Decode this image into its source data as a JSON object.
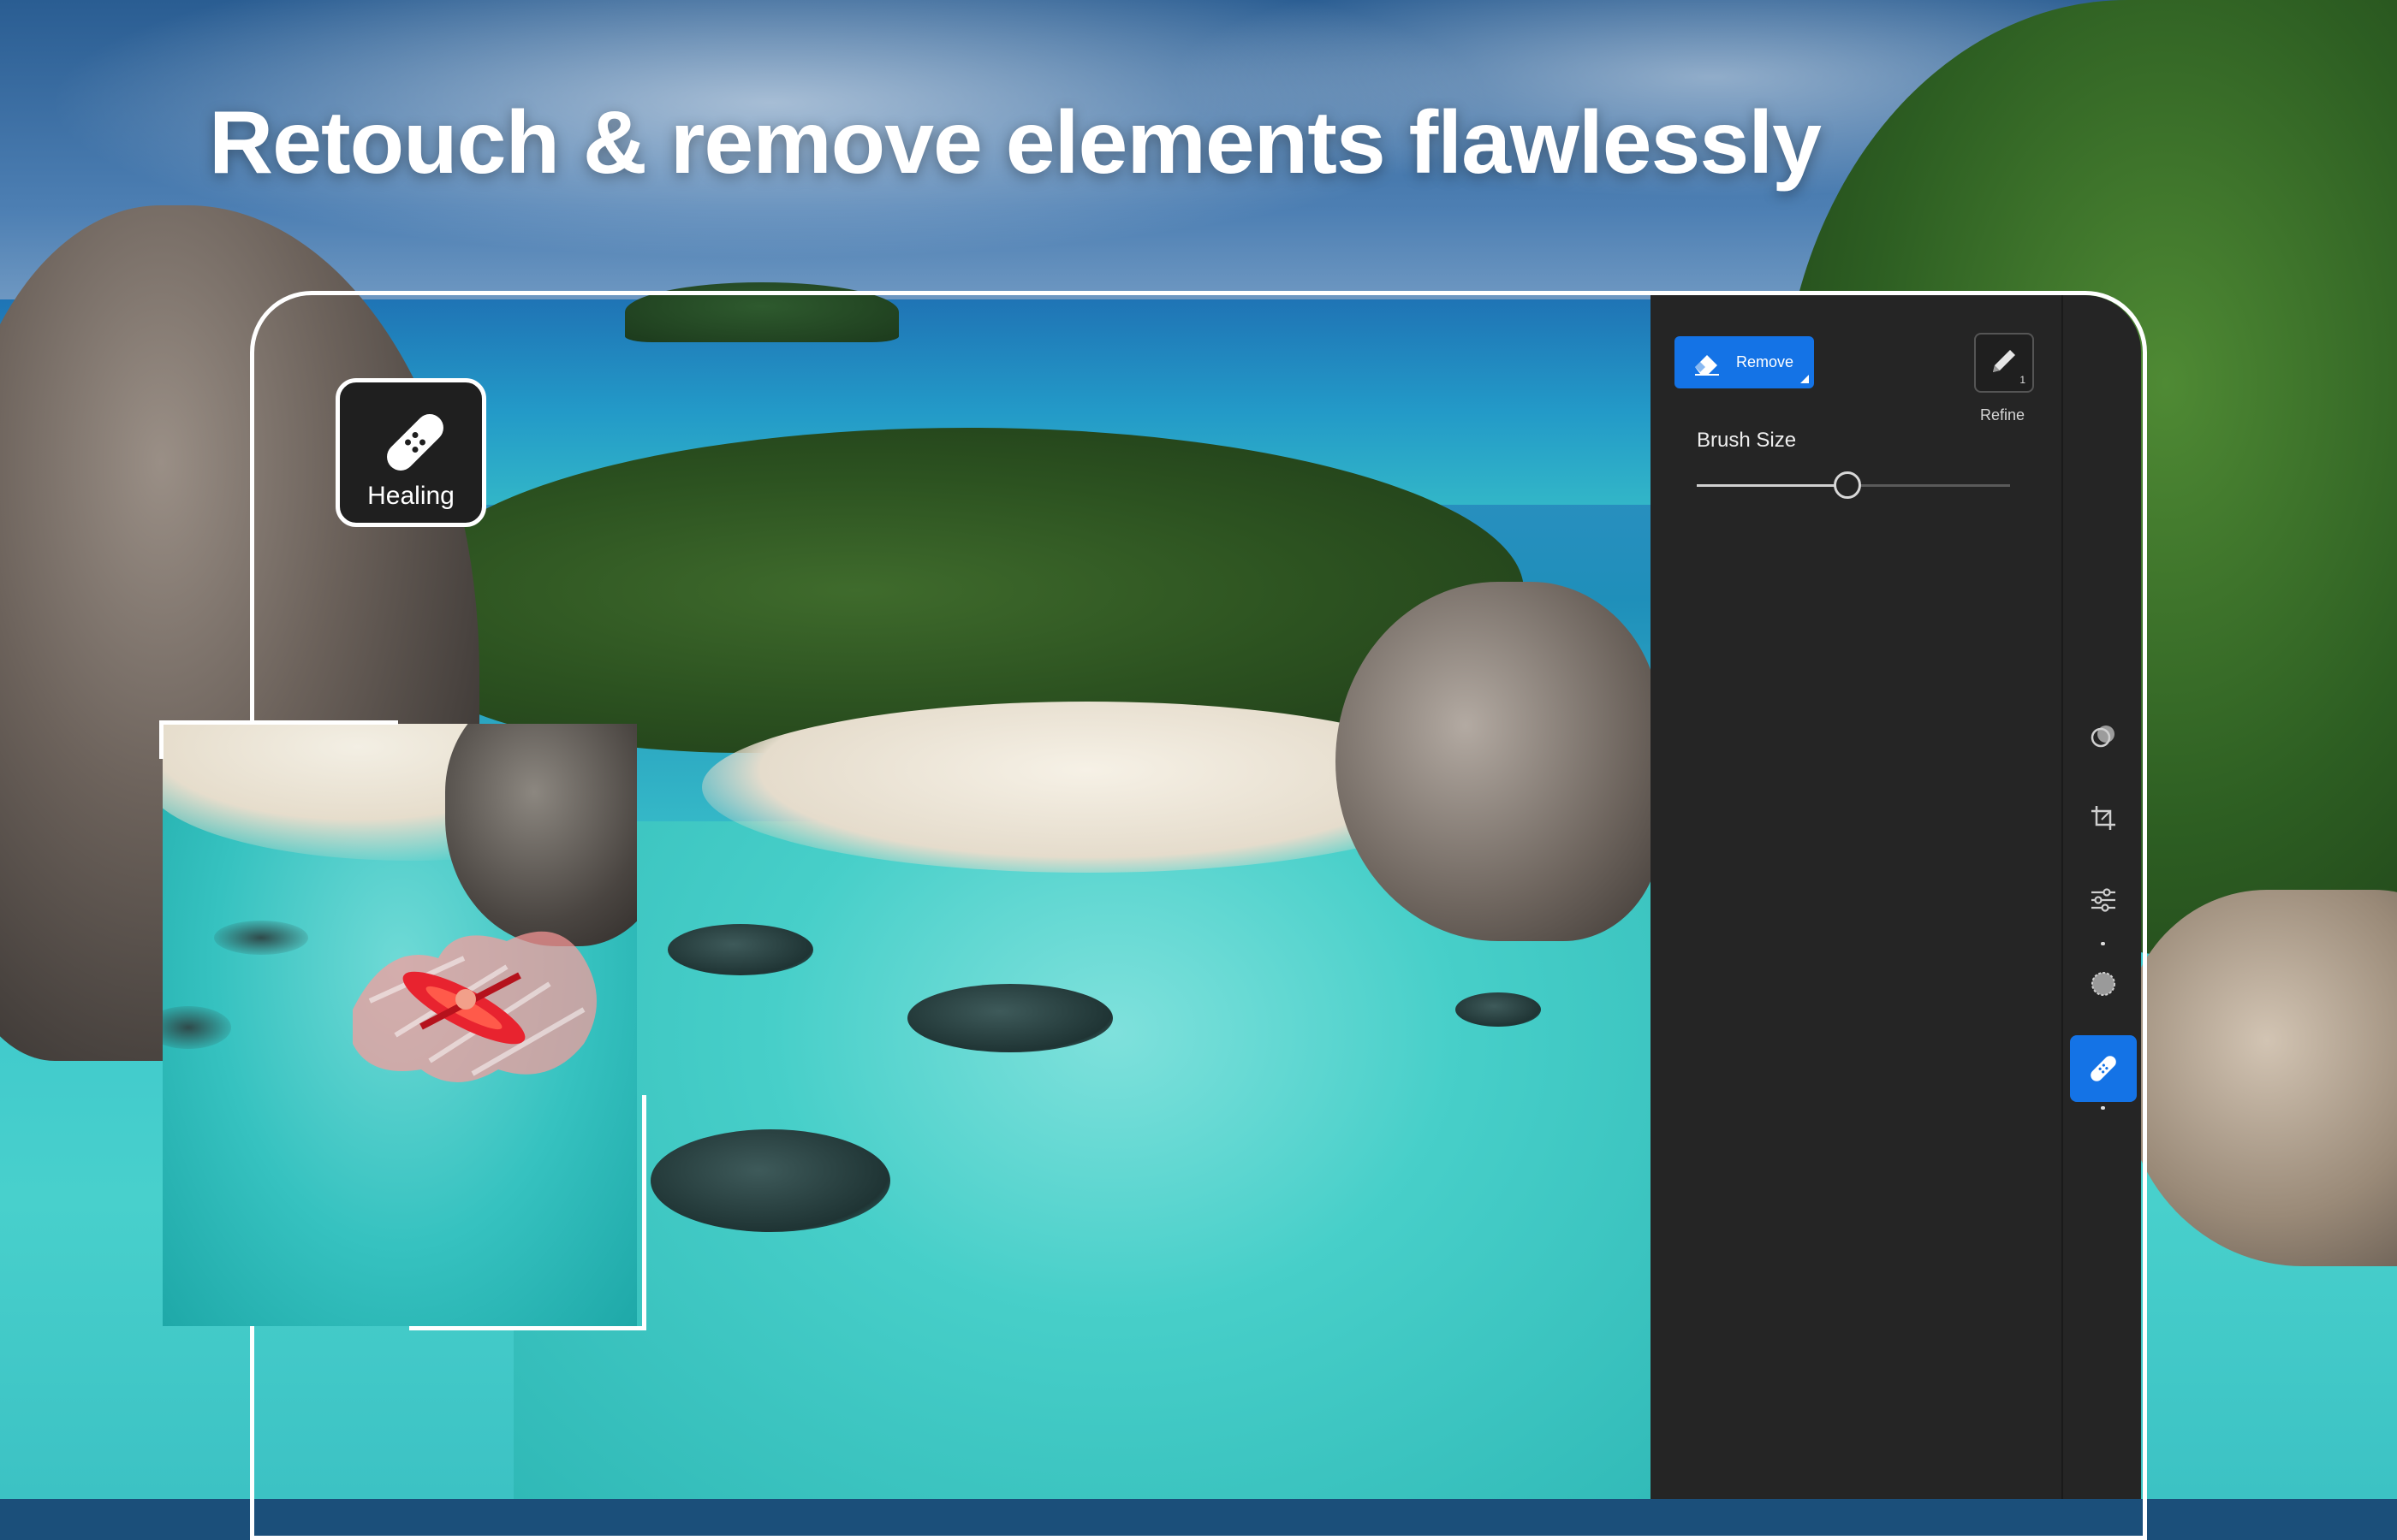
{
  "headline": "Retouch & remove elements flawlessly",
  "badge": {
    "label": "Healing",
    "icon": "bandage-icon"
  },
  "panel": {
    "remove_button_label": "Remove",
    "refine_label": "Refine",
    "refine_badge": "1",
    "brush_size_label": "Brush Size",
    "brush_size_value": 0.48
  },
  "toolbar": [
    {
      "icon": "mask-circles-icon",
      "active": false
    },
    {
      "icon": "crop-icon",
      "active": false
    },
    {
      "icon": "adjust-sliders-icon",
      "active": false
    },
    {
      "icon": "effects-dot-icon",
      "active": false
    },
    {
      "icon": "bandage-icon",
      "active": true
    }
  ],
  "colors": {
    "accent": "#1473e6",
    "panel": "#252525",
    "stroke_mask": "#ff9a9a"
  }
}
